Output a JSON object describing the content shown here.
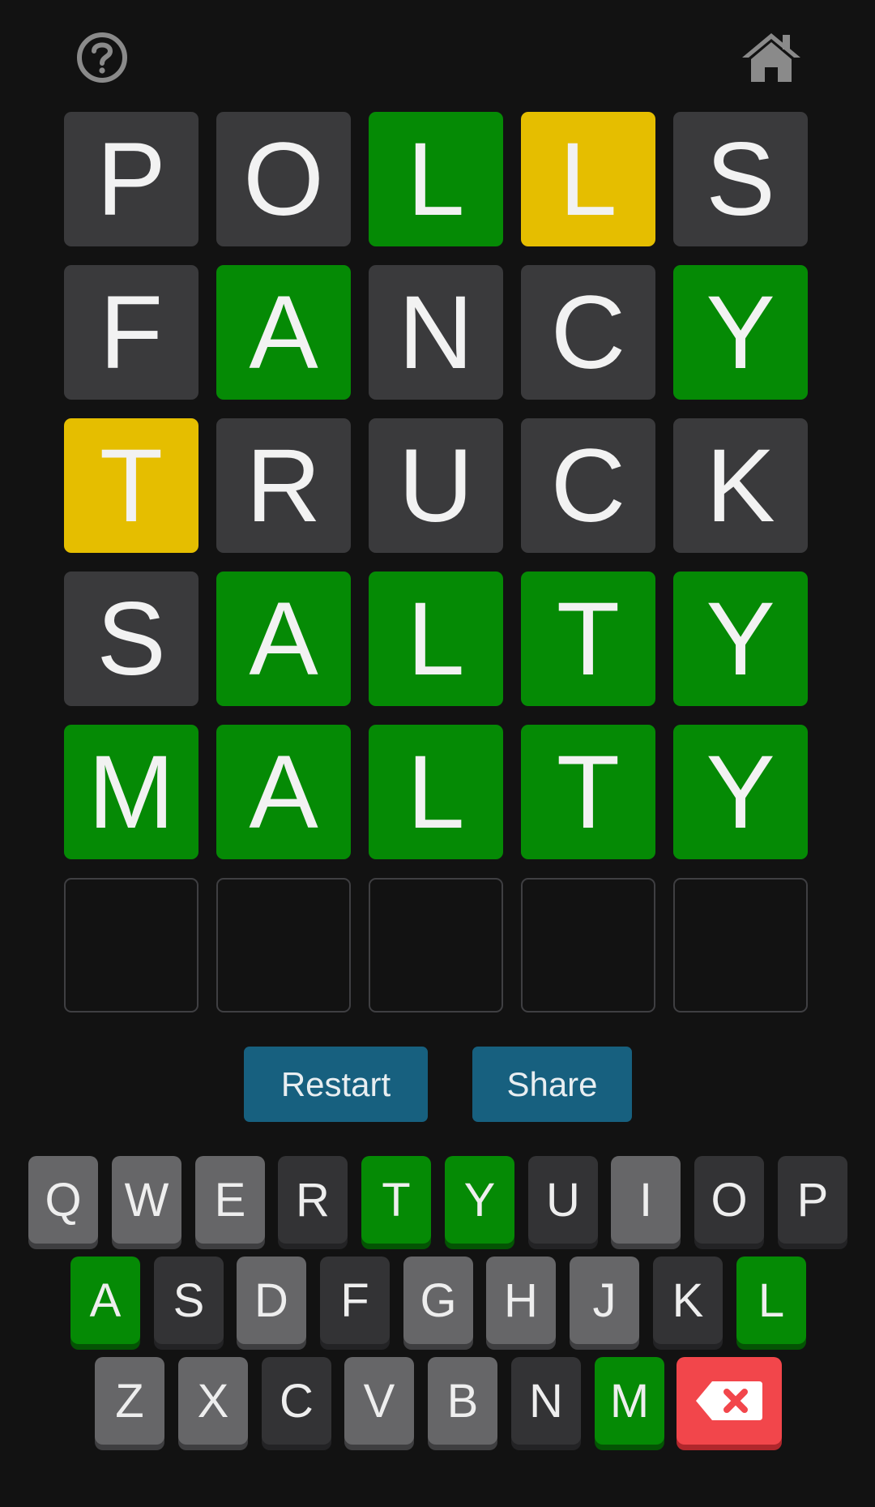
{
  "header": {
    "help_icon": "question-circle-icon",
    "home_icon": "home-icon",
    "icon_color": "#8a8a8a"
  },
  "board": {
    "rows": [
      [
        {
          "letter": "P",
          "state": "absent"
        },
        {
          "letter": "O",
          "state": "absent"
        },
        {
          "letter": "L",
          "state": "correct"
        },
        {
          "letter": "L",
          "state": "present"
        },
        {
          "letter": "S",
          "state": "absent"
        }
      ],
      [
        {
          "letter": "F",
          "state": "absent"
        },
        {
          "letter": "A",
          "state": "correct"
        },
        {
          "letter": "N",
          "state": "absent"
        },
        {
          "letter": "C",
          "state": "absent"
        },
        {
          "letter": "Y",
          "state": "correct"
        }
      ],
      [
        {
          "letter": "T",
          "state": "present"
        },
        {
          "letter": "R",
          "state": "absent"
        },
        {
          "letter": "U",
          "state": "absent"
        },
        {
          "letter": "C",
          "state": "absent"
        },
        {
          "letter": "K",
          "state": "absent"
        }
      ],
      [
        {
          "letter": "S",
          "state": "absent"
        },
        {
          "letter": "A",
          "state": "correct"
        },
        {
          "letter": "L",
          "state": "correct"
        },
        {
          "letter": "T",
          "state": "correct"
        },
        {
          "letter": "Y",
          "state": "correct"
        }
      ],
      [
        {
          "letter": "M",
          "state": "correct"
        },
        {
          "letter": "A",
          "state": "correct"
        },
        {
          "letter": "L",
          "state": "correct"
        },
        {
          "letter": "T",
          "state": "correct"
        },
        {
          "letter": "Y",
          "state": "correct"
        }
      ],
      [
        {
          "letter": "",
          "state": "empty"
        },
        {
          "letter": "",
          "state": "empty"
        },
        {
          "letter": "",
          "state": "empty"
        },
        {
          "letter": "",
          "state": "empty"
        },
        {
          "letter": "",
          "state": "empty"
        }
      ]
    ]
  },
  "actions": {
    "restart_label": "Restart",
    "share_label": "Share"
  },
  "keyboard": {
    "rows": [
      [
        {
          "label": "Q",
          "state": "unused"
        },
        {
          "label": "W",
          "state": "unused"
        },
        {
          "label": "E",
          "state": "unused"
        },
        {
          "label": "R",
          "state": "absent"
        },
        {
          "label": "T",
          "state": "correct"
        },
        {
          "label": "Y",
          "state": "correct"
        },
        {
          "label": "U",
          "state": "absent"
        },
        {
          "label": "I",
          "state": "unused"
        },
        {
          "label": "O",
          "state": "absent"
        },
        {
          "label": "P",
          "state": "absent"
        }
      ],
      [
        {
          "label": "A",
          "state": "correct"
        },
        {
          "label": "S",
          "state": "absent"
        },
        {
          "label": "D",
          "state": "unused"
        },
        {
          "label": "F",
          "state": "absent"
        },
        {
          "label": "G",
          "state": "unused"
        },
        {
          "label": "H",
          "state": "unused"
        },
        {
          "label": "J",
          "state": "unused"
        },
        {
          "label": "K",
          "state": "absent"
        },
        {
          "label": "L",
          "state": "correct"
        }
      ],
      [
        {
          "label": "Z",
          "state": "unused"
        },
        {
          "label": "X",
          "state": "unused"
        },
        {
          "label": "C",
          "state": "absent"
        },
        {
          "label": "V",
          "state": "unused"
        },
        {
          "label": "B",
          "state": "unused"
        },
        {
          "label": "N",
          "state": "absent"
        },
        {
          "label": "M",
          "state": "correct"
        }
      ]
    ],
    "backspace_icon": "backspace-icon"
  },
  "colors": {
    "background": "#121212",
    "correct": "#058a05",
    "present": "#e5be00",
    "absent": "#3a3a3c",
    "button": "#17607f",
    "backspace": "#f2464b"
  }
}
